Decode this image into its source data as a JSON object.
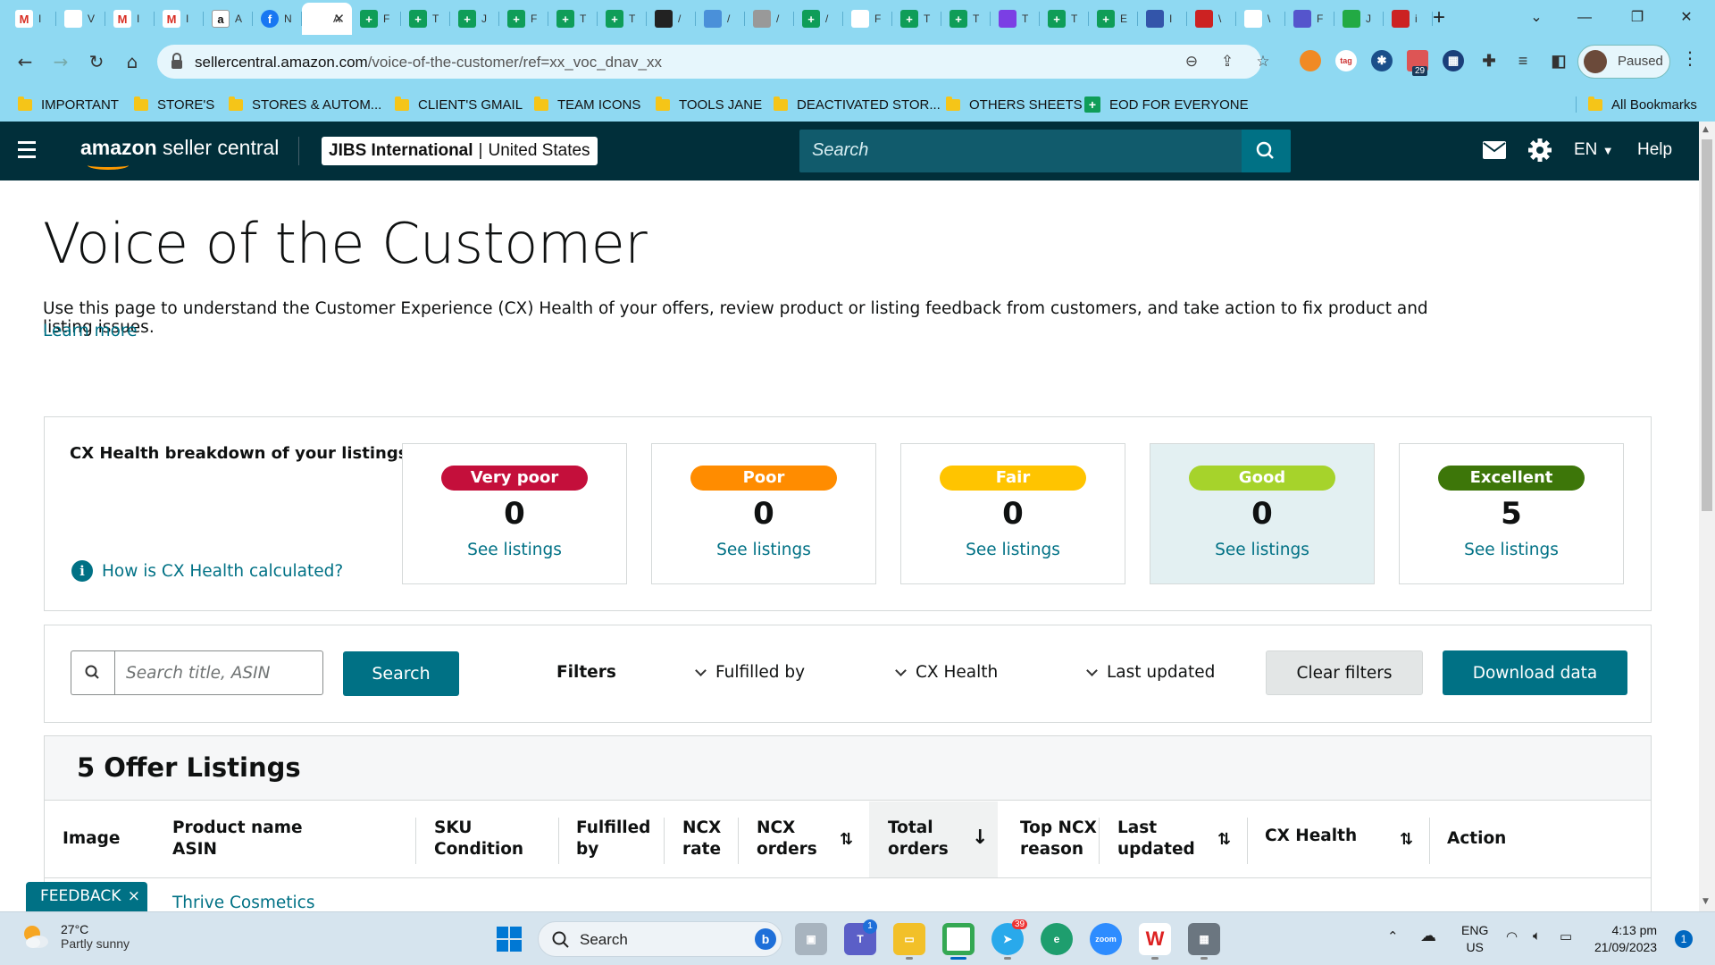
{
  "browser": {
    "tabs": [
      {
        "icon": "gmail-icon",
        "label": "I",
        "color": "#ffffff"
      },
      {
        "icon": "drive-icon",
        "label": "V",
        "color": "#ffffff"
      },
      {
        "icon": "gmail-icon",
        "label": "I",
        "color": "#ffffff"
      },
      {
        "icon": "gmail-icon",
        "label": "I",
        "color": "#ffffff"
      },
      {
        "icon": "amazon-icon",
        "label": "A",
        "color": "#ffffff"
      },
      {
        "icon": "facebook-icon",
        "label": "N",
        "color": "#1877f2"
      },
      {
        "icon": "amazon-tab-icon",
        "label": "A",
        "color": "#ffffff",
        "active": true
      },
      {
        "icon": "sheets-icon",
        "label": "F",
        "color": "#0f9d58"
      },
      {
        "icon": "sheets-icon",
        "label": "T",
        "color": "#0f9d58"
      },
      {
        "icon": "sheets-icon",
        "label": "J",
        "color": "#0f9d58"
      },
      {
        "icon": "sheets-icon",
        "label": "F",
        "color": "#0f9d58"
      },
      {
        "icon": "sheets-icon",
        "label": "T",
        "color": "#0f9d58"
      },
      {
        "icon": "sheets-icon",
        "label": "T",
        "color": "#0f9d58"
      },
      {
        "icon": "threads-icon",
        "label": "/",
        "color": "#222222"
      },
      {
        "icon": "pen-icon",
        "label": "/",
        "color": "#4a90d9"
      },
      {
        "icon": "globe-icon",
        "label": "/",
        "color": "#999999"
      },
      {
        "icon": "sheets-icon",
        "label": "/",
        "color": "#0f9d58"
      },
      {
        "icon": "docs-icon",
        "label": "F",
        "color": "#ffffff"
      },
      {
        "icon": "sheets-icon",
        "label": "T",
        "color": "#0f9d58"
      },
      {
        "icon": "sheets-icon",
        "label": "T",
        "color": "#0f9d58"
      },
      {
        "icon": "messenger-icon",
        "label": "T",
        "color": "#7b3fe4"
      },
      {
        "icon": "sheets-icon",
        "label": "T",
        "color": "#0f9d58"
      },
      {
        "icon": "sheets-icon",
        "label": "E",
        "color": "#0f9d58"
      },
      {
        "icon": "gradient-icon",
        "label": "I",
        "color": "#3355aa"
      },
      {
        "icon": "walmart-icon",
        "label": "\\",
        "color": "#cc2222"
      },
      {
        "icon": "microsoft-icon",
        "label": "\\",
        "color": "#ffffff"
      },
      {
        "icon": "slides-icon",
        "label": "F",
        "color": "#5555cc"
      },
      {
        "icon": "w-icon",
        "label": "J",
        "color": "#22aa44"
      },
      {
        "icon": "shield-icon",
        "label": "i",
        "color": "#cc2222"
      }
    ],
    "new_tab": "+",
    "url_domain": "sellercentral.amazon.com",
    "url_path": "/voice-of-the-customer/ref=xx_voc_dnav_xx",
    "profile_label": "Paused",
    "ext_badge": "29",
    "bookmarks": [
      {
        "label": "IMPORTANT",
        "type": "folder"
      },
      {
        "label": "STORE'S",
        "type": "folder"
      },
      {
        "label": "STORES & AUTOM...",
        "type": "folder"
      },
      {
        "label": "CLIENT'S GMAIL",
        "type": "folder"
      },
      {
        "label": "TEAM ICONS",
        "type": "folder"
      },
      {
        "label": "TOOLS JANE",
        "type": "folder"
      },
      {
        "label": "DEACTIVATED STOR...",
        "type": "folder"
      },
      {
        "label": "OTHERS SHEETS",
        "type": "folder"
      },
      {
        "label": "EOD FOR EVERYONE",
        "type": "sheets"
      }
    ],
    "all_bookmarks": "All Bookmarks"
  },
  "header": {
    "brand_bold": "amazon",
    "brand_rest": " seller central",
    "store_name": "JIBS International",
    "store_sep": "|",
    "store_region": "United States",
    "search_placeholder": "Search",
    "lang": "EN",
    "help": "Help"
  },
  "page": {
    "title": "Voice of the Customer",
    "description": "Use this page to understand the Customer Experience (CX) Health of your offers, review product or listing feedback from customers, and take action to fix product and listing issues.",
    "learn_more": "Learn more"
  },
  "cx": {
    "heading": "CX Health breakdown of your listings",
    "how_link": "How is CX Health calculated?",
    "info_glyph": "i",
    "cards": [
      {
        "label": "Very poor",
        "count": "0",
        "link": "See listings",
        "color": "#c40f3b"
      },
      {
        "label": "Poor",
        "count": "0",
        "link": "See listings",
        "color": "#ff8c00"
      },
      {
        "label": "Fair",
        "count": "0",
        "link": "See listings",
        "color": "#ffc400"
      },
      {
        "label": "Good",
        "count": "0",
        "link": "See listings",
        "color": "#a6d32b",
        "selected": true
      },
      {
        "label": "Excellent",
        "count": "5",
        "link": "See listings",
        "color": "#3d7609"
      }
    ]
  },
  "filters": {
    "search_placeholder": "Search title, ASIN",
    "search_button": "Search",
    "label": "Filters",
    "dropdowns": [
      "Fulfilled by",
      "CX Health",
      "Last updated"
    ],
    "clear": "Clear filters",
    "download": "Download data"
  },
  "listings": {
    "title": "5 Offer Listings",
    "columns": [
      {
        "l1": "Image",
        "l2": ""
      },
      {
        "l1": "Product name",
        "l2": "ASIN"
      },
      {
        "l1": "SKU",
        "l2": "Condition"
      },
      {
        "l1": "Fulfilled",
        "l2": "by"
      },
      {
        "l1": "NCX",
        "l2": "rate"
      },
      {
        "l1": "NCX",
        "l2": "orders"
      },
      {
        "l1": "Total",
        "l2": "orders"
      },
      {
        "l1": "Top NCX",
        "l2": "reason"
      },
      {
        "l1": "Last",
        "l2": "updated"
      },
      {
        "l1": "CX Health",
        "l2": ""
      },
      {
        "l1": "Action",
        "l2": ""
      }
    ],
    "first_row_product": "Thrive Cosmetics"
  },
  "feedback": {
    "label": "FEEDBACK",
    "close": "×"
  },
  "taskbar": {
    "weather_temp": "27°C",
    "weather_desc": "Partly sunny",
    "search_label": "Search",
    "teams_badge": "1",
    "telegram_badge": "39",
    "lang_1": "ENG",
    "lang_2": "US",
    "time": "4:13 pm",
    "date": "21/09/2023",
    "notification_count": "1"
  }
}
